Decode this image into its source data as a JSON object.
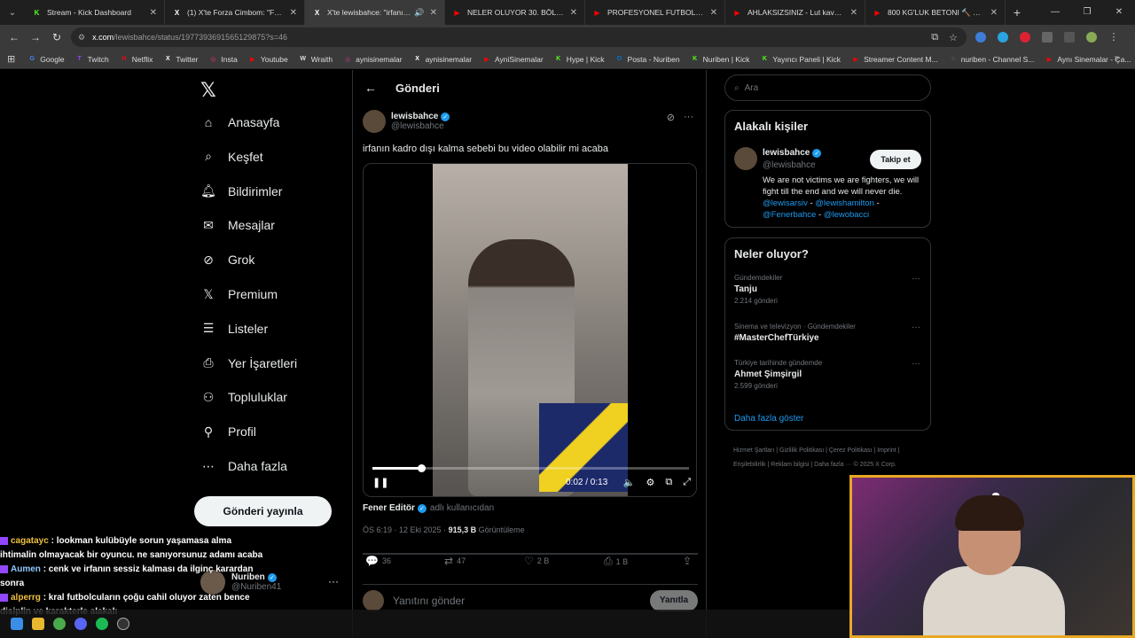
{
  "browser": {
    "tabs": [
      {
        "title": "Stream - Kick Dashboard",
        "fav": "K",
        "fav_color": "#53fc18",
        "active": false
      },
      {
        "title": "(1) X'te Forza Cimbom: \"FENERBAHÇE",
        "fav": "X",
        "fav_color": "#ffffff",
        "active": false
      },
      {
        "title": "X'te lewisbahce: \"irfanın kadro",
        "fav": "X",
        "fav_color": "#ffffff",
        "active": true
      },
      {
        "title": "NELER OLUYOR 30. BÖLÜM - YouTube",
        "fav": "▶",
        "fav_color": "#ff0000",
        "active": false
      },
      {
        "title": "PROFESYONEL FUTBOLCU SENDROMU",
        "fav": "▶",
        "fav_color": "#ff0000",
        "active": false
      },
      {
        "title": "AHLAKSIZSINIZ - Lut kavminden",
        "fav": "▶",
        "fav_color": "#ff0000",
        "active": false
      },
      {
        "title": "800 KG'LUK BETONI 🔨 KIRAR MISIN",
        "fav": "▶",
        "fav_color": "#ff0000",
        "active": false
      }
    ],
    "new_tab": "+",
    "address": {
      "host": "x.com",
      "path": "/lewisbahce/status/1977393691565129875?s=46"
    },
    "bookmarks": [
      {
        "label": "Google",
        "color": "#4285f4",
        "glyph": "G"
      },
      {
        "label": "Twitch",
        "color": "#9146ff",
        "glyph": "T"
      },
      {
        "label": "Netflix",
        "color": "#e50914",
        "glyph": "N"
      },
      {
        "label": "Twitter",
        "color": "#ffffff",
        "glyph": "X"
      },
      {
        "label": "Insta",
        "color": "#e1306c",
        "glyph": "◎"
      },
      {
        "label": "Youtube",
        "color": "#ff0000",
        "glyph": "▶"
      },
      {
        "label": "Wraith",
        "color": "#dddddd",
        "glyph": "W"
      },
      {
        "label": "aynisinemalar",
        "color": "#c13584",
        "glyph": "◎"
      },
      {
        "label": "aynisinemalar",
        "color": "#ffffff",
        "glyph": "X"
      },
      {
        "label": "AyniSinemalar",
        "color": "#ff0000",
        "glyph": "▶"
      },
      {
        "label": "Hype | Kick",
        "color": "#53fc18",
        "glyph": "K"
      },
      {
        "label": "Posta - Nuriben",
        "color": "#0078d4",
        "glyph": "O"
      },
      {
        "label": "Nuriben | Kick",
        "color": "#53fc18",
        "glyph": "K"
      },
      {
        "label": "Yayıncı Paneli | Kick",
        "color": "#53fc18",
        "glyph": "K"
      },
      {
        "label": "Streamer Content M...",
        "color": "#ff0000",
        "glyph": "▶"
      },
      {
        "label": "nuriben - Channel S...",
        "color": "#9aa0a6",
        "glyph": "◌"
      },
      {
        "label": "Aynı Sinemalar - Ça...",
        "color": "#ff0000",
        "glyph": "▶"
      }
    ]
  },
  "nav": {
    "items": [
      {
        "label": "Anasayfa",
        "icon": "home-icon"
      },
      {
        "label": "Keşfet",
        "icon": "search-icon"
      },
      {
        "label": "Bildirimler",
        "icon": "bell-icon"
      },
      {
        "label": "Mesajlar",
        "icon": "mail-icon"
      },
      {
        "label": "Grok",
        "icon": "grok-icon"
      },
      {
        "label": "Premium",
        "icon": "x-icon"
      },
      {
        "label": "Listeler",
        "icon": "list-icon"
      },
      {
        "label": "Yer İşaretleri",
        "icon": "bookmark-icon"
      },
      {
        "label": "Topluluklar",
        "icon": "community-icon"
      },
      {
        "label": "Profil",
        "icon": "person-icon"
      },
      {
        "label": "Daha fazla",
        "icon": "more-circle-icon"
      }
    ],
    "post_button": "Gönderi yayınla",
    "account": {
      "name": "Nuriben",
      "handle": "@Nuriben41"
    }
  },
  "post": {
    "header": "Gönderi",
    "author": {
      "name": "lewisbahce",
      "handle": "@lewisbahce"
    },
    "text": "irfanın kadro dışı kalma sebebi bu video olabilir mi acaba",
    "video": {
      "time": "0:02 / 0:13",
      "progress": 0.154
    },
    "source_name": "Fener Editör",
    "source_suffix": "adlı kullanıcıdan",
    "meta_time": "ÖS 6:19 · 12 Eki 2025 · ",
    "views": "915,3 B",
    "views_label": " Görüntüleme",
    "counts": {
      "replies": "36",
      "reposts": "47",
      "likes": "2 B",
      "bookmarks": "1 B"
    },
    "reply_placeholder": "Yanıtını gönder",
    "reply_button": "Yanıtla"
  },
  "sidebar": {
    "search_placeholder": "Ara",
    "related_title": "Alakalı kişiler",
    "related": {
      "name": "lewisbahce",
      "handle": "@lewisbahce",
      "follow": "Takip et",
      "bio": "We are not victims we are fighters, we will fight till the end and we will never die.",
      "links": [
        "@lewisarsiv",
        "@lewishamilton",
        "@Fenerbahce",
        "@lewobacci"
      ]
    },
    "trends_title": "Neler oluyor?",
    "trends": [
      {
        "category": "Gündemdekiler",
        "name": "Tanju",
        "count": "2.214 gönderi"
      },
      {
        "category": "Sinema ve televizyon · Gündemdekiler",
        "name": "#MasterChefTürkiye",
        "count": ""
      },
      {
        "category": "Türkiye tarihinde gündemde",
        "name": "Ahmet Şimşirgil",
        "count": "2.599 gönderi"
      }
    ],
    "more_link": "Daha fazla göster",
    "footer": "Hizmet Şartları  |  Gizlilik Politikası  |  Çerez Politikası  |  Imprint  |  Erişilebilirlik  |  Reklam bilgisi  |  Daha fazla ···  © 2025 X Corp."
  },
  "chat": [
    {
      "user": "cagatayc",
      "msg": ": lookman kulübüyle sorun yaşamasa alma ihtimalin olmayacak bir oyuncu. ne sanıyorsunuz adamı acaba"
    },
    {
      "user": "Aumen",
      "msg": ": cenk ve irfanın sessiz kalması da ilginç karardan sonra"
    },
    {
      "user": "alperrg",
      "msg": ": kral futbolcuların çoğu cahil oluyor zaten bence disiplin ve karakterle alakalı"
    }
  ],
  "colors": {
    "accent": "#1d9bf0",
    "cam_border": "#e8a823"
  }
}
